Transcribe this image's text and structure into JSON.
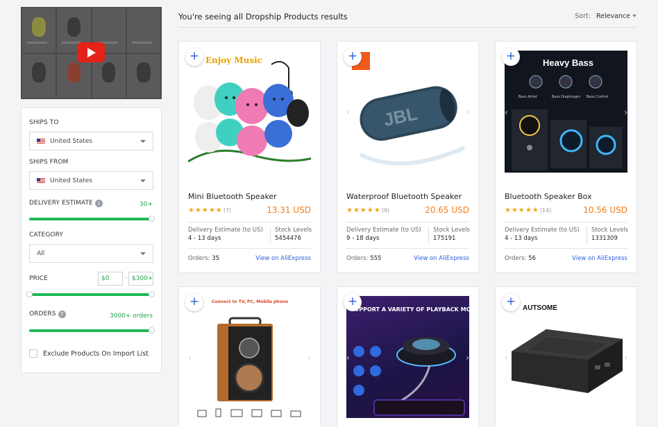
{
  "video": {
    "play_icon": "play-icon"
  },
  "filters": {
    "ships_to_label": "SHIPS TO",
    "ships_to_value": "United States",
    "ships_from_label": "SHIPS FROM",
    "ships_from_value": "United States",
    "delivery_label": "DELIVERY ESTIMATE",
    "delivery_value": "30+",
    "delivery_level": 1.0,
    "category_label": "CATEGORY",
    "category_value": "All",
    "price_label": "PRICE",
    "price_min": "$0",
    "price_max": "$300+",
    "price_range": [
      0.0,
      1.0
    ],
    "orders_label": "ORDERS",
    "orders_value": "3000+ orders",
    "orders_level": 1.0,
    "exclude_label": "Exclude Products On Import List",
    "info_glyph": "i",
    "help_glyph": "?"
  },
  "header": {
    "title": "You're seeing all Dropship Products results",
    "sort_label": "Sort:",
    "sort_value": "Relevance"
  },
  "products": [
    {
      "title": "Mini Bluetooth Speaker",
      "stars": "★★★★★",
      "reviews": "(7)",
      "price": "13.31 USD",
      "delivery_label": "Delivery Estimate (to US)",
      "delivery": "4 - 13 days",
      "stock_label": "Stock Levels",
      "stock": "5454476",
      "orders_label": "Orders:",
      "orders": "35",
      "link": "View on AliExpress",
      "image_text": "Enjoy Music"
    },
    {
      "title": "Waterproof Bluetooth Speaker",
      "stars": "★★★★★",
      "reviews": "(9)",
      "price": "20.65 USD",
      "delivery_label": "Delivery Estimate (to US)",
      "delivery": "9 - 18 days",
      "stock_label": "Stock Levels",
      "stock": "175191",
      "orders_label": "Orders:",
      "orders": "555",
      "link": "View on AliExpress",
      "image_text": "JBL"
    },
    {
      "title": "Bluetooth Speaker Box",
      "stars": "★★★★★",
      "reviews": "(14)",
      "price": "10.56 USD",
      "delivery_label": "Delivery Estimate (to US)",
      "delivery": "4 - 13 days",
      "stock_label": "Stock Levels",
      "stock": "1331309",
      "orders_label": "Orders:",
      "orders": "56",
      "link": "View on AliExpress",
      "image_text": "Heavy Bass",
      "image_sub": [
        "Bass Airlet",
        "Bass Diaphragm",
        "Bass Control"
      ]
    },
    {
      "image_text": "Connect to TV, PC, Mobile phone"
    },
    {
      "image_text": "SUPPORT A VARIETY OF PLAYBACK MODE"
    },
    {
      "image_text": "AUTSOME"
    }
  ],
  "glyphs": {
    "plus": "+",
    "prev": "‹",
    "next": "›"
  }
}
